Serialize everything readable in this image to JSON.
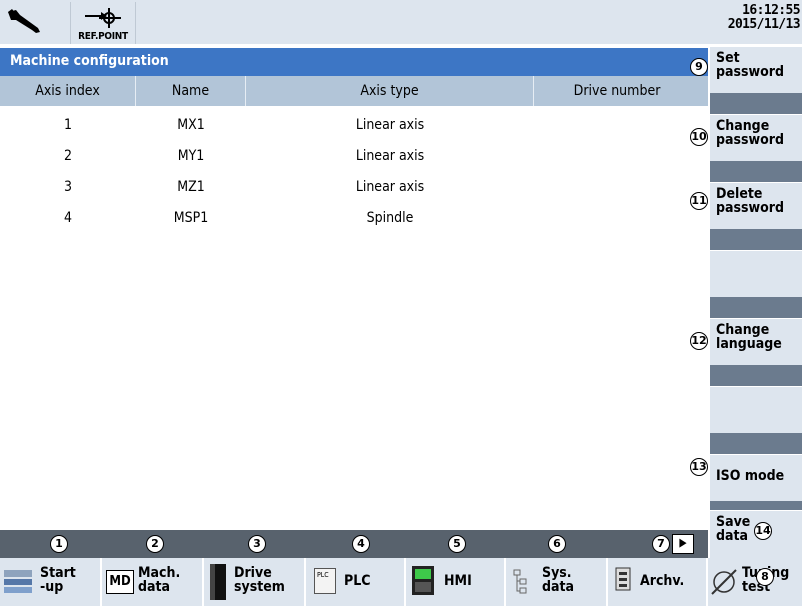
{
  "status": {
    "ref_point_label": "REF.POINT",
    "time": "16:12:55",
    "date": "2015/11/13"
  },
  "title": "Machine configuration",
  "table": {
    "headers": [
      "Axis index",
      "Name",
      "Axis type",
      "Drive number"
    ],
    "rows": [
      [
        "1",
        "MX1",
        "Linear axis",
        ""
      ],
      [
        "2",
        "MY1",
        "Linear axis",
        ""
      ],
      [
        "3",
        "MZ1",
        "Linear axis",
        ""
      ],
      [
        "4",
        "MSP1",
        "Spindle",
        ""
      ]
    ]
  },
  "vertical_softkeys": [
    {
      "label_line1": "Set",
      "label_line2": "password",
      "marker": "9"
    },
    {
      "label_line1": "Change",
      "label_line2": "password",
      "marker": "10"
    },
    {
      "label_line1": "Delete",
      "label_line2": "password",
      "marker": "11"
    },
    {
      "label_line1": "",
      "label_line2": "",
      "marker": ""
    },
    {
      "label_line1": "Change",
      "label_line2": "language",
      "marker": "12"
    },
    {
      "label_line1": "",
      "label_line2": "",
      "marker": ""
    },
    {
      "label_line1": "ISO mode",
      "label_line2": "",
      "marker": "13"
    },
    {
      "label_line1": "Save",
      "label_line2": "data",
      "marker": "14"
    }
  ],
  "horizontal_softkeys": [
    {
      "label_line1": "Start",
      "label_line2": "-up",
      "marker": "1",
      "icon": "startup-icon"
    },
    {
      "label_line1": "Mach.",
      "label_line2": "data",
      "marker": "2",
      "icon": "md-icon"
    },
    {
      "label_line1": "Drive",
      "label_line2": "system",
      "marker": "3",
      "icon": "drive-icon"
    },
    {
      "label_line1": "PLC",
      "label_line2": "",
      "marker": "4",
      "icon": "plc-icon"
    },
    {
      "label_line1": "HMI",
      "label_line2": "",
      "marker": "5",
      "icon": "hmi-icon"
    },
    {
      "label_line1": "Sys.",
      "label_line2": "data",
      "marker": "6",
      "icon": "sysdata-icon"
    },
    {
      "label_line1": "Archv.",
      "label_line2": "",
      "marker": "7",
      "icon": "archive-icon"
    },
    {
      "label_line1": "Tuning",
      "label_line2": "test",
      "marker": "8",
      "icon": "tuning-icon"
    }
  ],
  "md_icon_text": "MD",
  "plc_icon_text": "PLC",
  "more_arrow": ">",
  "colors": {
    "title_bar": "#3d76c5",
    "header": "#b2c5d8",
    "softkey": "#dde5ee",
    "dark_strip": "#58626d"
  }
}
